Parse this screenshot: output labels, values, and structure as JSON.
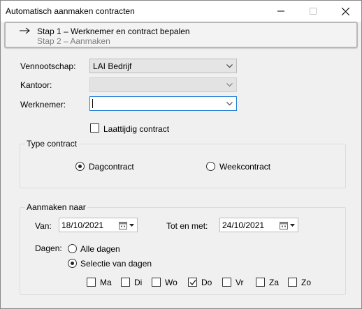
{
  "window": {
    "title": "Automatisch aanmaken contracten"
  },
  "steps": {
    "step1": "Stap 1 – Werknemer en contract bepalen",
    "step2": "Stap 2 – Aanmaken"
  },
  "form": {
    "vennootschap_label": "Vennootschap:",
    "vennootschap_value": "LAI Bedrijf",
    "kantoor_label": "Kantoor:",
    "kantoor_value": "",
    "werknemer_label": "Werknemer:",
    "werknemer_value": "",
    "laattijdig_label": "Laattijdig contract",
    "laattijdig_checked": false
  },
  "type_contract": {
    "title": "Type contract",
    "option_dag": "Dagcontract",
    "option_week": "Weekcontract",
    "selected": "Dagcontract"
  },
  "aanmaken_naar": {
    "title": "Aanmaken naar",
    "van_label": "Van:",
    "van_value": "18/10/2021",
    "tot_label": "Tot en met:",
    "tot_value": "24/10/2021",
    "dagen_label": "Dagen:",
    "alle_dagen": "Alle dagen",
    "selectie": "Selectie van dagen",
    "selected": "Selectie van dagen",
    "days": [
      {
        "label": "Ma",
        "checked": false
      },
      {
        "label": "Di",
        "checked": false
      },
      {
        "label": "Wo",
        "checked": false
      },
      {
        "label": "Do",
        "checked": true
      },
      {
        "label": "Vr",
        "checked": false
      },
      {
        "label": "Za",
        "checked": false
      },
      {
        "label": "Zo",
        "checked": false
      }
    ]
  },
  "colors": {
    "focus_border": "#1f7ad6",
    "dialog_bg": "#f0f0f0"
  }
}
